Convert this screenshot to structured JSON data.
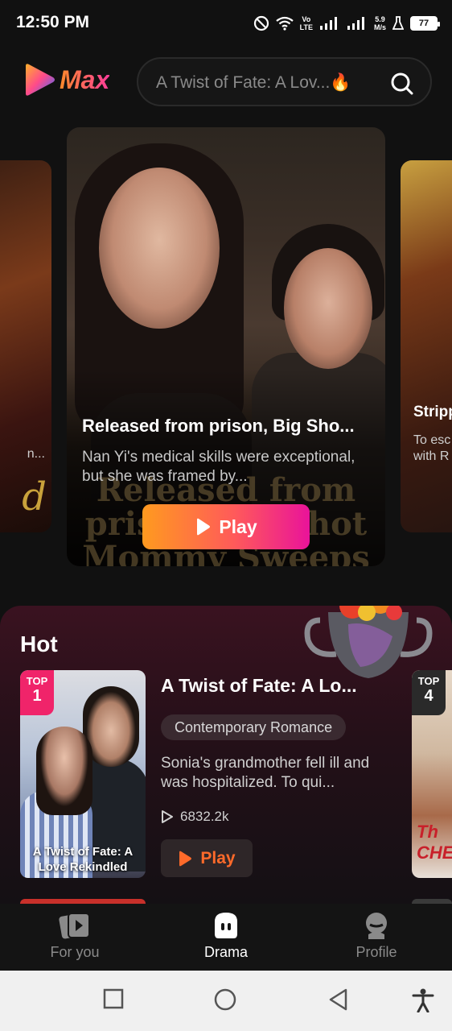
{
  "status_bar": {
    "time": "12:50 PM",
    "net_speed_value": "5.9",
    "net_speed_unit": "M/s",
    "volte": "Vo",
    "lte": "LTE",
    "battery": "77"
  },
  "header": {
    "logo_text": "Max",
    "search_placeholder": "A Twist of Fate: A Lov...🔥"
  },
  "carousel": {
    "featured": {
      "title": "Released from prison, Big Sho...",
      "description": "Nan Yi's medical skills were exceptional, but she was framed by...",
      "overlay_title": "Released from prison Big Shot Mommy Sweeps the",
      "play_label": "Play"
    },
    "right_card": {
      "title": "Stripp",
      "description_line1": "To esc",
      "description_line2": "with R"
    },
    "left_card": {
      "text": "n...",
      "big_letter": "d"
    }
  },
  "hot": {
    "section_title": "Hot",
    "item": {
      "rank_label": "TOP",
      "rank": "1",
      "poster_caption": "A Twist of Fate: A Love Rekindled",
      "title": "A Twist of Fate: A Lo...",
      "genre": "Contemporary Romance",
      "description": "Sonia's grandmother fell ill and was hospitalized. To qui...",
      "views": "6832.2k",
      "play_label": "Play"
    },
    "next_item": {
      "rank_label": "TOP",
      "rank": "4",
      "poster_text": "Th CHE"
    }
  },
  "bottom_nav": {
    "items": [
      {
        "label": "For you",
        "icon": "for-you-icon",
        "active": false
      },
      {
        "label": "Drama",
        "icon": "drama-icon",
        "active": true
      },
      {
        "label": "Profile",
        "icon": "profile-icon",
        "active": false
      }
    ]
  },
  "colors": {
    "background": "#111111",
    "accent_gradient_start": "#ff9a1f",
    "accent_gradient_end": "#e9139a",
    "top_badge": "#f0246a",
    "play_text": "#ff6a2a"
  }
}
